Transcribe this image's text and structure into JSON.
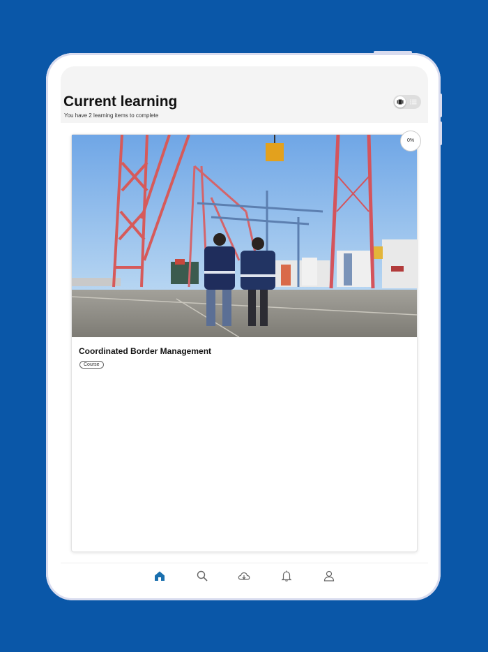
{
  "header": {
    "title": "Current learning",
    "subtitle": "You have 2 learning items to complete",
    "view_toggle": {
      "selected": "card-view-icon",
      "other": "list-view-icon"
    }
  },
  "course_card": {
    "title": "Coordinated Border Management",
    "type": "Course",
    "progress": "0%",
    "image": "port-container-cranes-photo"
  },
  "tab_bar": {
    "active_color": "#1a6fae",
    "inactive_color": "#666666",
    "tabs": [
      {
        "icon": "home-icon",
        "active": true
      },
      {
        "icon": "search-icon",
        "active": false
      },
      {
        "icon": "cloud-download-icon",
        "active": false
      },
      {
        "icon": "bell-icon",
        "active": false
      },
      {
        "icon": "profile-icon",
        "active": false
      }
    ]
  },
  "colors": {
    "background": "#0a57a8",
    "header_bg": "#f4f4f4"
  }
}
